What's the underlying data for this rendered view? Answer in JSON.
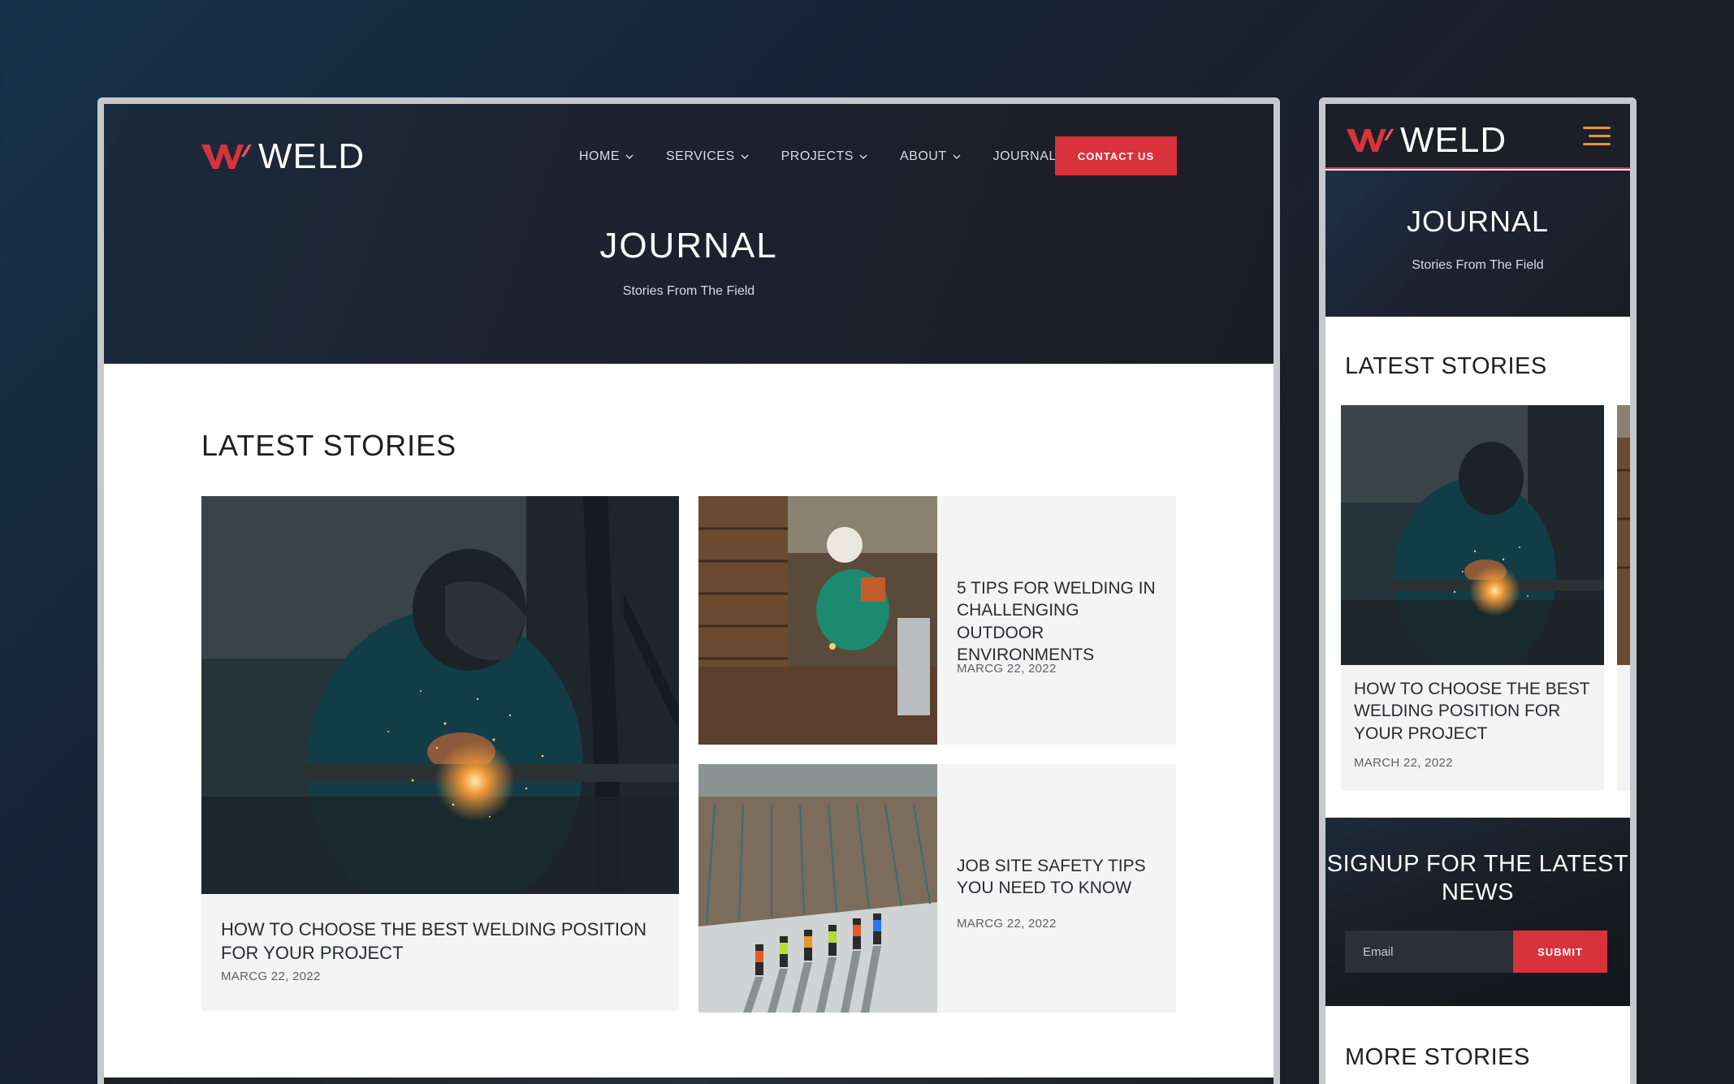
{
  "brand": {
    "name": "WELD",
    "mark_color": "#d8323c",
    "accent": "#d8323c",
    "menu_icon_color": "#e8952f"
  },
  "desktop": {
    "nav": [
      {
        "label": "HOME"
      },
      {
        "label": "SERVICES"
      },
      {
        "label": "PROJECTS"
      },
      {
        "label": "ABOUT"
      },
      {
        "label": "JOURNAL"
      }
    ],
    "contact_label": "CONTACT US",
    "hero": {
      "title": "JOURNAL",
      "subtitle": "Stories From The Field"
    },
    "section_title": "LATEST STORIES",
    "stories": [
      {
        "title": "HOW TO CHOOSE THE BEST WELDING POSITION FOR YOUR PROJECT",
        "date": "MARCG 22, 2022",
        "image": "welder-sparks-photo"
      },
      {
        "title": "5 TIPS FOR WELDING IN CHALLENGING OUTDOOR ENVIRONMENTS",
        "date": "MARCG 22, 2022",
        "image": "outdoor-welder-photo"
      },
      {
        "title": "JOB SITE SAFETY TIPS YOU NEED TO KNOW",
        "date": "MARCG 22, 2022",
        "image": "job-site-workers-photo"
      }
    ]
  },
  "mobile": {
    "hero": {
      "title": "JOURNAL",
      "subtitle": "Stories From The Field"
    },
    "section_title": "LATEST STORIES",
    "story": {
      "title": "HOW TO CHOOSE THE BEST WELDING POSITION FOR YOUR PROJECT",
      "date": "MARCH 22, 2022"
    },
    "signup": {
      "title": "SIGNUP FOR THE LATEST NEWS",
      "email_placeholder": "Email",
      "submit_label": "SUBMIT"
    },
    "more_title": "MORE STORIES"
  },
  "icons": [
    "weld-logo-icon",
    "chevron-down-icon",
    "hamburger-menu-icon"
  ]
}
